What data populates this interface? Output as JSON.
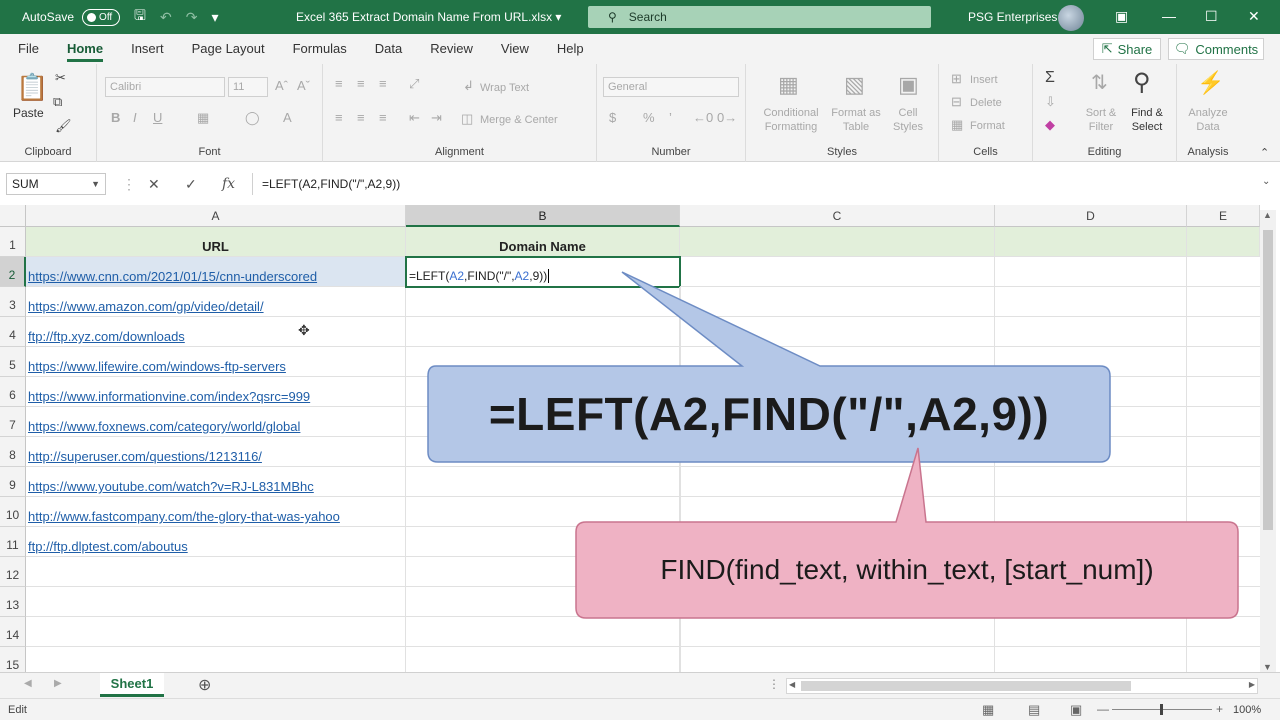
{
  "titlebar": {
    "autosave_label": "AutoSave",
    "autosave_state": "Off",
    "filename": "Excel 365 Extract Domain Name From URL.xlsx",
    "search_label": "Search",
    "user_name": "PSG Enterprises"
  },
  "ribbon": {
    "tabs": [
      "File",
      "Home",
      "Insert",
      "Page Layout",
      "Formulas",
      "Data",
      "Review",
      "View",
      "Help"
    ],
    "active_tab": "Home",
    "share_label": "Share",
    "comments_label": "Comments",
    "clipboard": {
      "paste_label": "Paste",
      "group_label": "Clipboard"
    },
    "font": {
      "font_name": "Calibri",
      "font_size": "11",
      "group_label": "Font"
    },
    "alignment": {
      "wrap_label": "Wrap Text",
      "merge_label": "Merge & Center",
      "group_label": "Alignment"
    },
    "number": {
      "format": "General",
      "group_label": "Number"
    },
    "styles": {
      "cf_line1": "Conditional",
      "cf_line2": "Formatting",
      "fat_line1": "Format as",
      "fat_line2": "Table",
      "cs_line1": "Cell",
      "cs_line2": "Styles",
      "group_label": "Styles"
    },
    "cells": {
      "insert_label": "Insert",
      "delete_label": "Delete",
      "format_label": "Format",
      "group_label": "Cells"
    },
    "editing": {
      "sort_line1": "Sort &",
      "sort_line2": "Filter",
      "find_line1": "Find &",
      "find_line2": "Select",
      "group_label": "Editing"
    },
    "analysis": {
      "line1": "Analyze",
      "line2": "Data",
      "group_label": "Analysis"
    }
  },
  "formula_bar": {
    "name_box": "SUM",
    "formula": "=LEFT(A2,FIND(\"/\",A2,9))"
  },
  "sheet": {
    "columns": [
      "A",
      "B",
      "C",
      "D",
      "E"
    ],
    "selected_column": "B",
    "header_row": {
      "a": "URL",
      "b": "Domain Name"
    },
    "rows": [
      {
        "num": "1"
      },
      {
        "num": "2",
        "url": "https://www.cnn.com/2021/01/15/cnn-underscored"
      },
      {
        "num": "3",
        "url": "https://www.amazon.com/gp/video/detail/"
      },
      {
        "num": "4",
        "url": "ftp://ftp.xyz.com/downloads"
      },
      {
        "num": "5",
        "url": "https://www.lifewire.com/windows-ftp-servers"
      },
      {
        "num": "6",
        "url": "https://www.informationvine.com/index?qsrc=999"
      },
      {
        "num": "7",
        "url": "https://www.foxnews.com/category/world/global"
      },
      {
        "num": "8",
        "url": "http://superuser.com/questions/1213116/"
      },
      {
        "num": "9",
        "url": "https://www.youtube.com/watch?v=RJ-L831MBhc"
      },
      {
        "num": "10",
        "url": "http://www.fastcompany.com/the-glory-that-was-yahoo"
      },
      {
        "num": "11",
        "url": "ftp://ftp.dlptest.com/aboutus"
      },
      {
        "num": "12"
      },
      {
        "num": "13"
      },
      {
        "num": "14"
      },
      {
        "num": "15"
      }
    ],
    "editing_cell": {
      "p1": "=LEFT(",
      "r1": "A2",
      "p2": ",FIND(\"/\",",
      "r2": "A2",
      "p3": ",9))"
    }
  },
  "callouts": {
    "formula_callout": "=LEFT(A2,FIND(\"/\",A2,9))",
    "syntax_callout": "FIND(find_text, within_text, [start_num])",
    "formula_callout_color": "#b4c7e7",
    "syntax_callout_color": "#efb2c4"
  },
  "sheet_tabs": {
    "active": "Sheet1"
  },
  "status": {
    "mode": "Edit",
    "zoom": "100%"
  },
  "colors": {
    "excel_green": "#217346",
    "link_blue": "#1f5ea8",
    "header_fill": "#e2efda"
  }
}
